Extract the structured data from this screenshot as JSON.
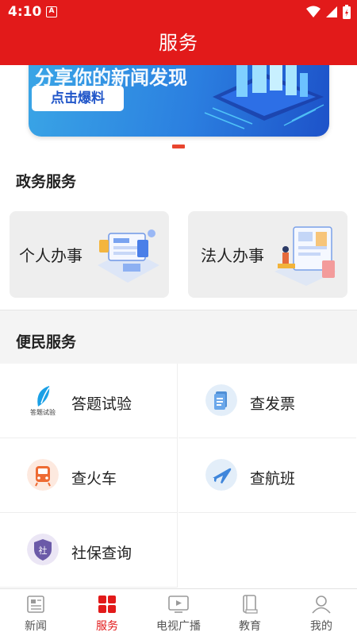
{
  "status_bar": {
    "time": "4:10",
    "notif_glyph": "A"
  },
  "header": {
    "title": "服务"
  },
  "banner": {
    "headline": "分享你的新闻发现",
    "cta": "点击爆料"
  },
  "gov_section": {
    "title": "政务服务",
    "cards": [
      {
        "label": "个人办事",
        "icon": "personal-affairs-illustration"
      },
      {
        "label": "法人办事",
        "icon": "corporate-affairs-illustration"
      }
    ]
  },
  "convenience_section": {
    "title": "便民服务",
    "items": [
      {
        "label": "答题试验",
        "icon": "quiz-icon",
        "icon_text": "答题试验"
      },
      {
        "label": "查发票",
        "icon": "invoice-icon"
      },
      {
        "label": "查火车",
        "icon": "train-icon"
      },
      {
        "label": "查航班",
        "icon": "airplane-icon"
      },
      {
        "label": "社保查询",
        "icon": "social-security-icon",
        "icon_text": "社"
      }
    ]
  },
  "bottom_nav": {
    "items": [
      {
        "label": "新闻",
        "icon": "news-icon",
        "active": false
      },
      {
        "label": "服务",
        "icon": "services-icon",
        "active": true
      },
      {
        "label": "电视广播",
        "icon": "tv-icon",
        "active": false
      },
      {
        "label": "教育",
        "icon": "education-icon",
        "active": false
      },
      {
        "label": "我的",
        "icon": "profile-icon",
        "active": false
      }
    ]
  },
  "colors": {
    "brand_red": "#e21a1a",
    "banner_blue": "#2b7fe0",
    "indicator": "#e8452e"
  }
}
